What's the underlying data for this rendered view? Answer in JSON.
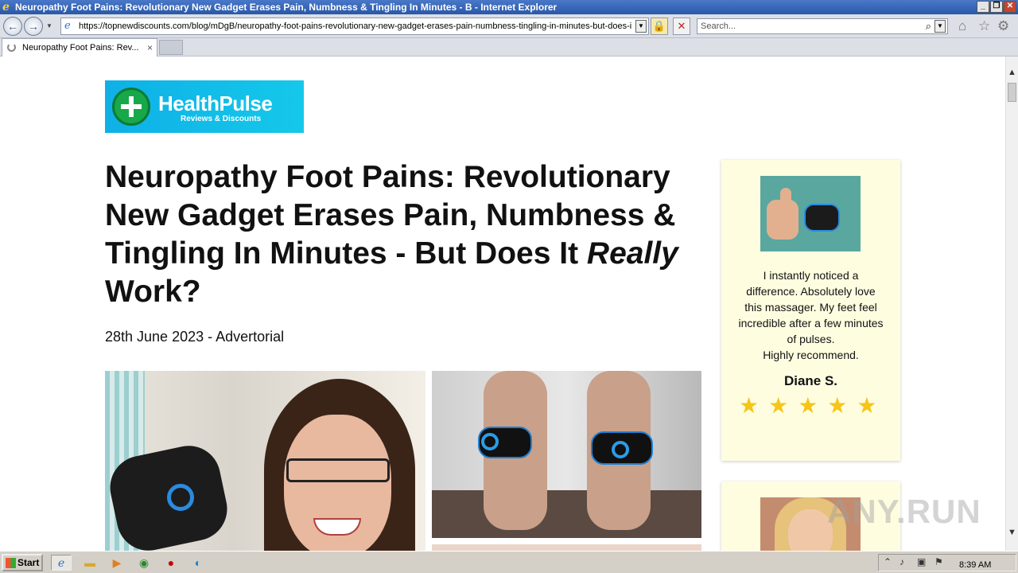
{
  "window": {
    "title": "Neuropathy Foot Pains: Revolutionary New Gadget Erases Pain, Numbness & Tingling In Minutes - B - Internet Explorer",
    "min": "_",
    "restore": "❐",
    "close": "✕"
  },
  "nav": {
    "back_icon": "←",
    "forward_icon": "→",
    "url": "https://topnewdiscounts.com/blog/mDgB/neuropathy-foot-pains-revolutionary-new-gadget-erases-pain-numbness-tingling-in-minutes-but-does-i",
    "lock_icon": "🔒",
    "stop_icon": "✕",
    "search_placeholder": "Search...",
    "home_icon": "⌂",
    "fav_icon": "☆",
    "gear_icon": "⚙"
  },
  "tab": {
    "label": "Neuropathy Foot Pains: Rev...",
    "close": "×"
  },
  "page": {
    "logo_name": "HealthPulse",
    "logo_sub": "Reviews & Discounts",
    "headline_main": "Neuropathy Foot Pains: Revolutionary New Gadget Erases Pain, Numbness & Tingling In Minutes - But Does It ",
    "headline_em": "Really",
    "headline_end": " Work?",
    "dateline": "28th June 2023 - Advertorial"
  },
  "sidebar": {
    "review1": {
      "text_lines": [
        "I instantly noticed a",
        "difference. Absolutely love",
        "this massager. My feet feel",
        "incredible after a few minutes",
        "of pulses.",
        "Highly recommend."
      ],
      "reviewer": "Diane S.",
      "stars": "★★★★★",
      "rating": 5
    }
  },
  "watermark": "ANY.RUN",
  "taskbar": {
    "start": "Start",
    "clock": "8:39 AM"
  },
  "colors": {
    "accent": "#15c8ea",
    "card_bg": "#fffde0",
    "star": "#f5c518"
  }
}
